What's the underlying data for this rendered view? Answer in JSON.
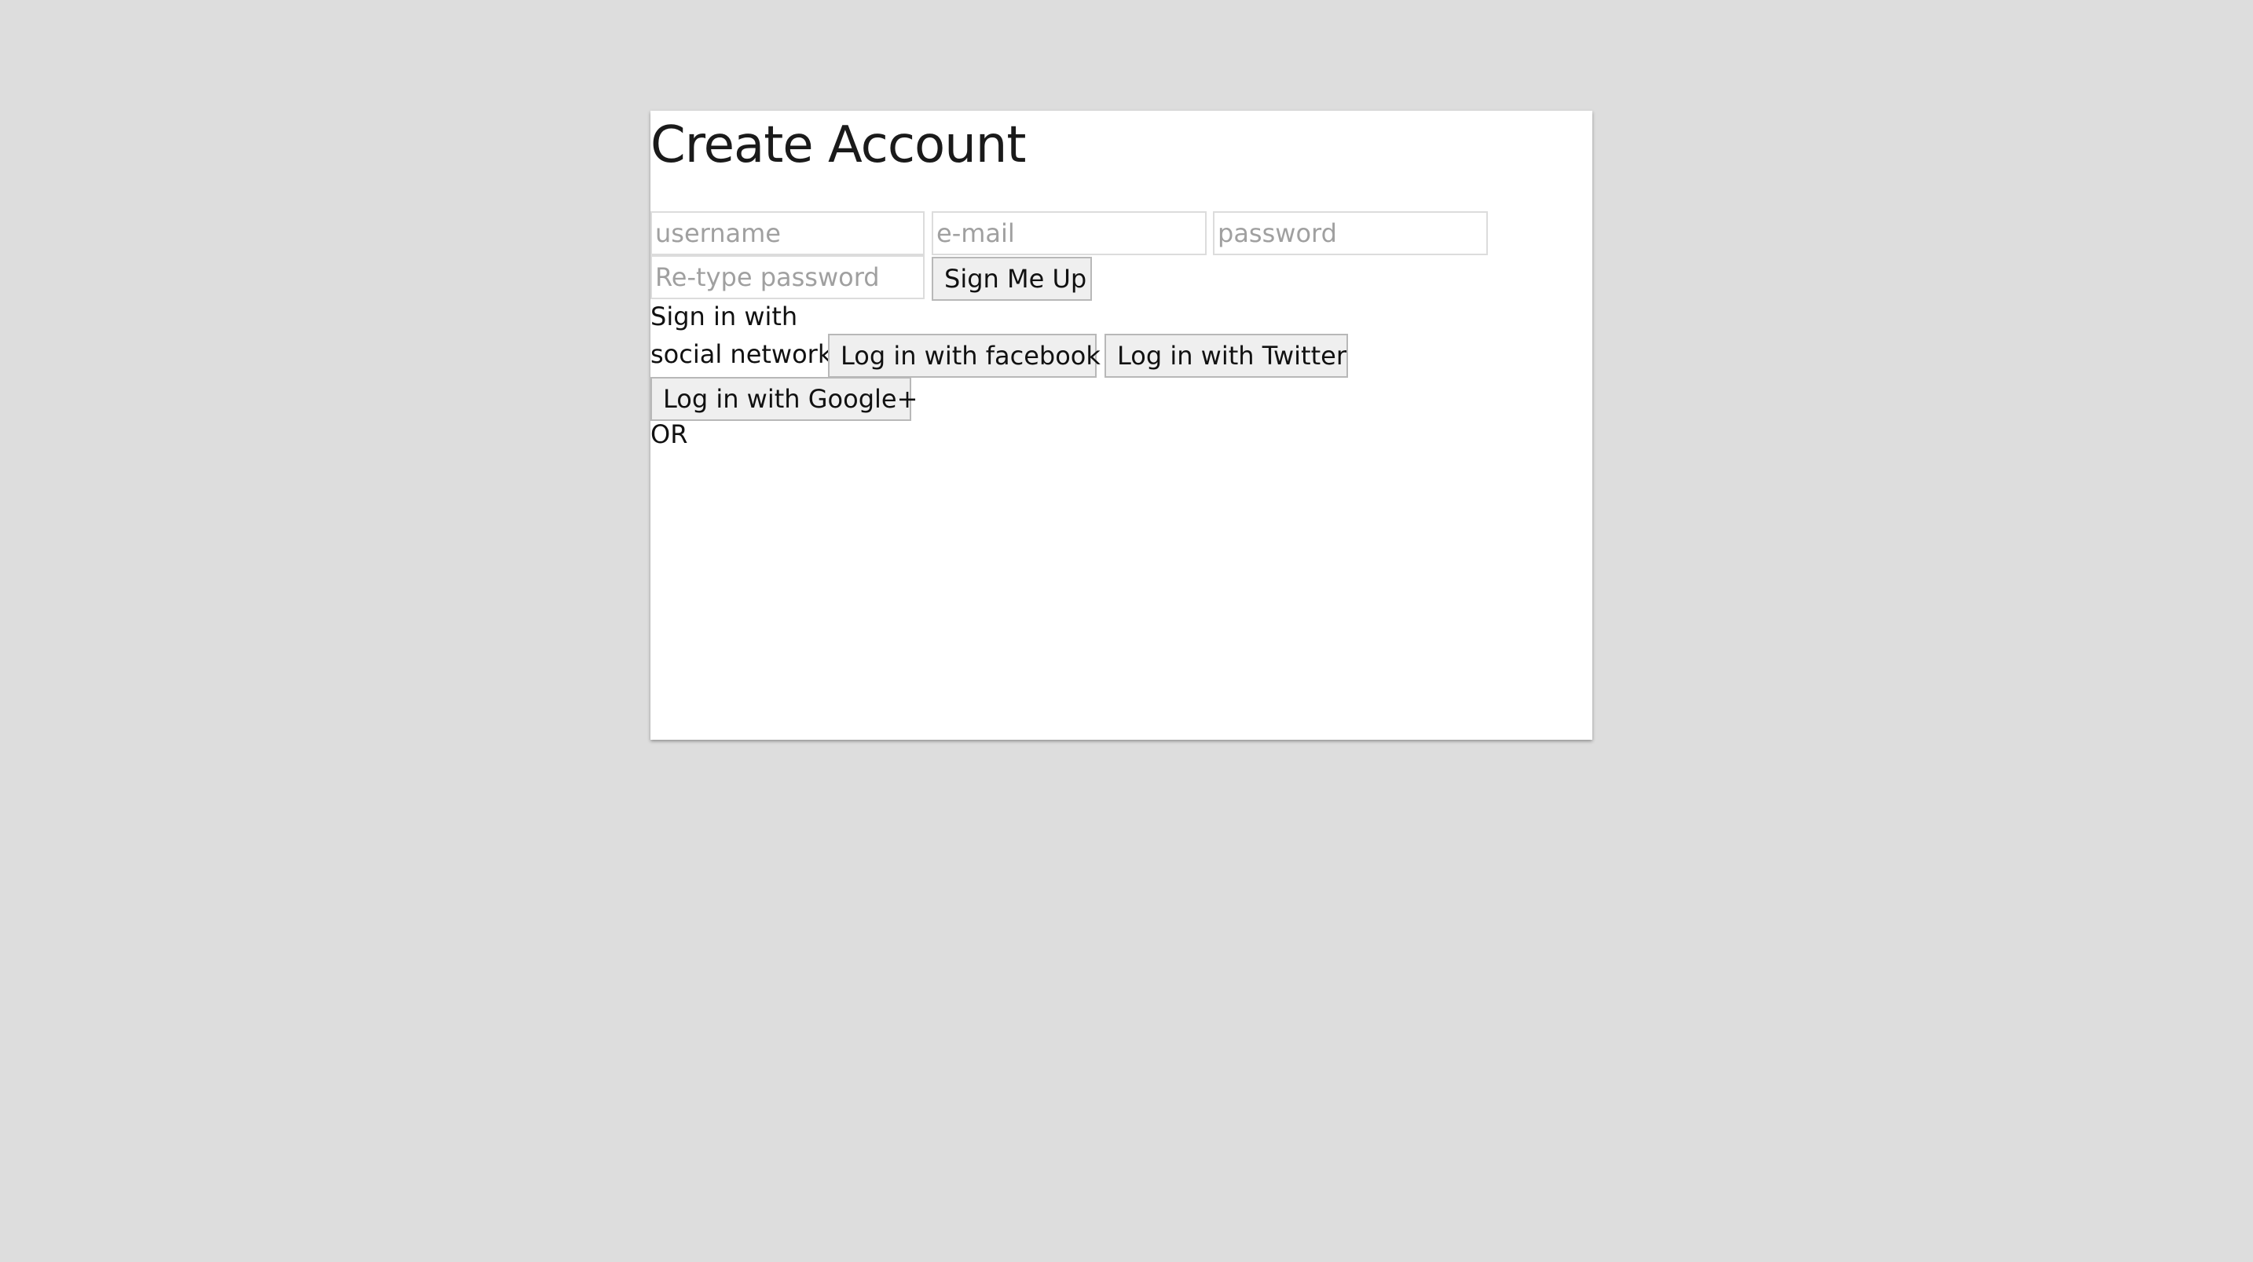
{
  "form": {
    "title": "Create Account",
    "username_placeholder": "username",
    "email_placeholder": "e-mail",
    "password_placeholder": "password",
    "retype_placeholder": "Re-type password",
    "submit_label": "Sign Me Up"
  },
  "social": {
    "label_line1": "Sign in with",
    "label_line2": "social network",
    "facebook_label": "Log in with facebook",
    "twitter_label": "Log in with Twitter",
    "google_label": "Log in with Google+"
  },
  "separator": {
    "label": "OR"
  }
}
